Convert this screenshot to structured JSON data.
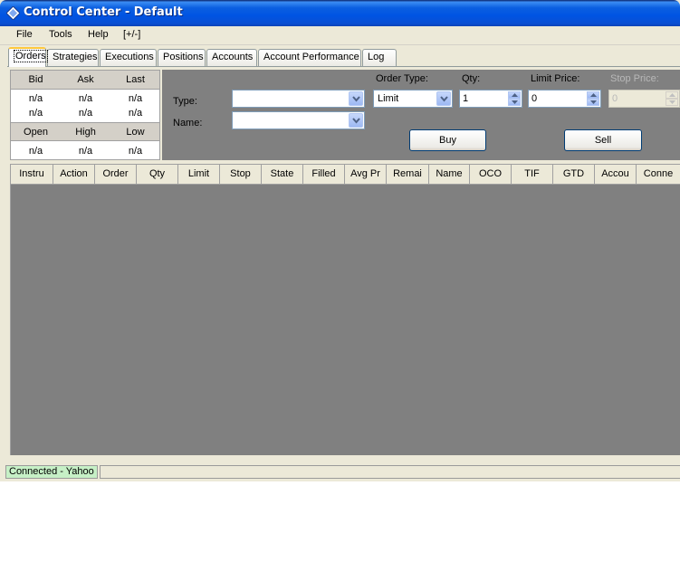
{
  "window": {
    "title": "Control Center - Default"
  },
  "menu": [
    "File",
    "Tools",
    "Help",
    "[+/-]"
  ],
  "tabs": [
    "Orders",
    "Strategies",
    "Executions",
    "Positions",
    "Accounts",
    "Account Performance",
    "Log"
  ],
  "active_tab": "Orders",
  "quote": {
    "headers_top": [
      "Bid",
      "Ask",
      "Last"
    ],
    "values_top": [
      "n/a",
      "n/a",
      "n/a"
    ],
    "values_mid": [
      "n/a",
      "n/a",
      "n/a"
    ],
    "headers_bottom": [
      "Open",
      "High",
      "Low"
    ],
    "values_bottom": [
      "n/a",
      "n/a",
      "n/a"
    ]
  },
  "order_entry": {
    "type_label": "Type:",
    "type_value": "",
    "name_label": "Name:",
    "name_value": "",
    "order_type_label": "Order Type:",
    "order_type_value": "Limit",
    "qty_label": "Qty:",
    "qty_value": "1",
    "limit_price_label": "Limit Price:",
    "limit_price_value": "0",
    "stop_price_label": "Stop Price:",
    "stop_price_value": "0",
    "buy_label": "Buy",
    "sell_label": "Sell"
  },
  "grid": {
    "columns": [
      "Instru",
      "Action",
      "Order",
      "Qty",
      "Limit",
      "Stop",
      "State",
      "Filled",
      "Avg Pr",
      "Remai",
      "Name",
      "OCO",
      "TIF",
      "GTD",
      "Accou",
      "Conne"
    ]
  },
  "status": {
    "connection": "Connected - Yahoo",
    "connection_color": "#c6f0c6"
  }
}
